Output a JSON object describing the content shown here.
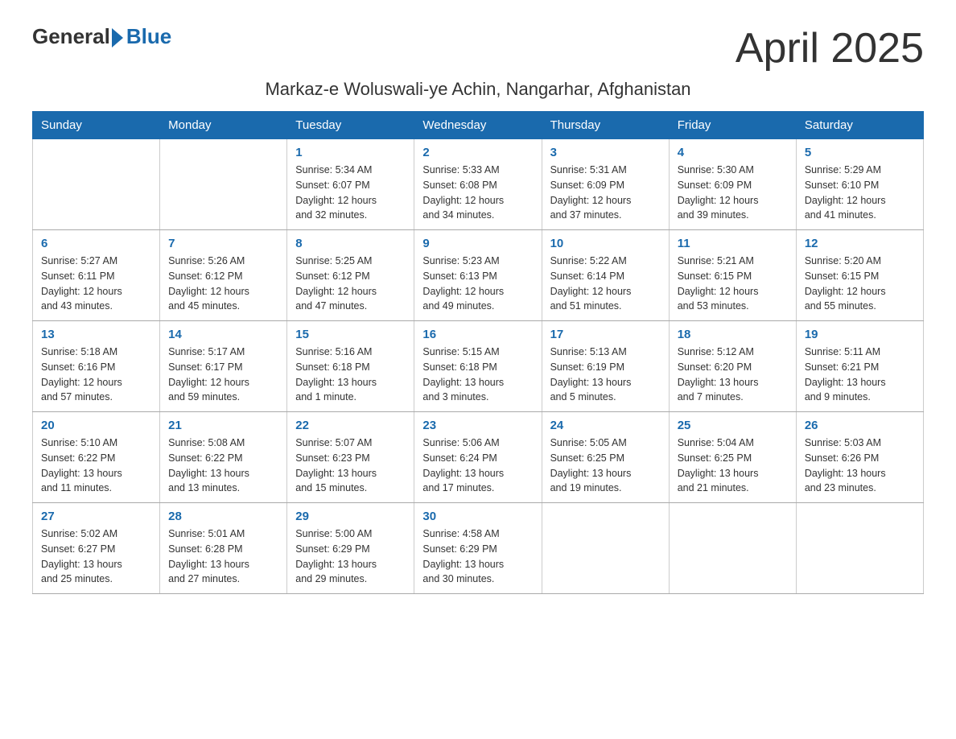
{
  "header": {
    "logo_general": "General",
    "logo_blue": "Blue",
    "month_title": "April 2025",
    "subtitle": "Markaz-e Woluswali-ye Achin, Nangarhar, Afghanistan"
  },
  "days_of_week": [
    "Sunday",
    "Monday",
    "Tuesday",
    "Wednesday",
    "Thursday",
    "Friday",
    "Saturday"
  ],
  "weeks": [
    [
      {
        "day": "",
        "info": ""
      },
      {
        "day": "",
        "info": ""
      },
      {
        "day": "1",
        "info": "Sunrise: 5:34 AM\nSunset: 6:07 PM\nDaylight: 12 hours\nand 32 minutes."
      },
      {
        "day": "2",
        "info": "Sunrise: 5:33 AM\nSunset: 6:08 PM\nDaylight: 12 hours\nand 34 minutes."
      },
      {
        "day": "3",
        "info": "Sunrise: 5:31 AM\nSunset: 6:09 PM\nDaylight: 12 hours\nand 37 minutes."
      },
      {
        "day": "4",
        "info": "Sunrise: 5:30 AM\nSunset: 6:09 PM\nDaylight: 12 hours\nand 39 minutes."
      },
      {
        "day": "5",
        "info": "Sunrise: 5:29 AM\nSunset: 6:10 PM\nDaylight: 12 hours\nand 41 minutes."
      }
    ],
    [
      {
        "day": "6",
        "info": "Sunrise: 5:27 AM\nSunset: 6:11 PM\nDaylight: 12 hours\nand 43 minutes."
      },
      {
        "day": "7",
        "info": "Sunrise: 5:26 AM\nSunset: 6:12 PM\nDaylight: 12 hours\nand 45 minutes."
      },
      {
        "day": "8",
        "info": "Sunrise: 5:25 AM\nSunset: 6:12 PM\nDaylight: 12 hours\nand 47 minutes."
      },
      {
        "day": "9",
        "info": "Sunrise: 5:23 AM\nSunset: 6:13 PM\nDaylight: 12 hours\nand 49 minutes."
      },
      {
        "day": "10",
        "info": "Sunrise: 5:22 AM\nSunset: 6:14 PM\nDaylight: 12 hours\nand 51 minutes."
      },
      {
        "day": "11",
        "info": "Sunrise: 5:21 AM\nSunset: 6:15 PM\nDaylight: 12 hours\nand 53 minutes."
      },
      {
        "day": "12",
        "info": "Sunrise: 5:20 AM\nSunset: 6:15 PM\nDaylight: 12 hours\nand 55 minutes."
      }
    ],
    [
      {
        "day": "13",
        "info": "Sunrise: 5:18 AM\nSunset: 6:16 PM\nDaylight: 12 hours\nand 57 minutes."
      },
      {
        "day": "14",
        "info": "Sunrise: 5:17 AM\nSunset: 6:17 PM\nDaylight: 12 hours\nand 59 minutes."
      },
      {
        "day": "15",
        "info": "Sunrise: 5:16 AM\nSunset: 6:18 PM\nDaylight: 13 hours\nand 1 minute."
      },
      {
        "day": "16",
        "info": "Sunrise: 5:15 AM\nSunset: 6:18 PM\nDaylight: 13 hours\nand 3 minutes."
      },
      {
        "day": "17",
        "info": "Sunrise: 5:13 AM\nSunset: 6:19 PM\nDaylight: 13 hours\nand 5 minutes."
      },
      {
        "day": "18",
        "info": "Sunrise: 5:12 AM\nSunset: 6:20 PM\nDaylight: 13 hours\nand 7 minutes."
      },
      {
        "day": "19",
        "info": "Sunrise: 5:11 AM\nSunset: 6:21 PM\nDaylight: 13 hours\nand 9 minutes."
      }
    ],
    [
      {
        "day": "20",
        "info": "Sunrise: 5:10 AM\nSunset: 6:22 PM\nDaylight: 13 hours\nand 11 minutes."
      },
      {
        "day": "21",
        "info": "Sunrise: 5:08 AM\nSunset: 6:22 PM\nDaylight: 13 hours\nand 13 minutes."
      },
      {
        "day": "22",
        "info": "Sunrise: 5:07 AM\nSunset: 6:23 PM\nDaylight: 13 hours\nand 15 minutes."
      },
      {
        "day": "23",
        "info": "Sunrise: 5:06 AM\nSunset: 6:24 PM\nDaylight: 13 hours\nand 17 minutes."
      },
      {
        "day": "24",
        "info": "Sunrise: 5:05 AM\nSunset: 6:25 PM\nDaylight: 13 hours\nand 19 minutes."
      },
      {
        "day": "25",
        "info": "Sunrise: 5:04 AM\nSunset: 6:25 PM\nDaylight: 13 hours\nand 21 minutes."
      },
      {
        "day": "26",
        "info": "Sunrise: 5:03 AM\nSunset: 6:26 PM\nDaylight: 13 hours\nand 23 minutes."
      }
    ],
    [
      {
        "day": "27",
        "info": "Sunrise: 5:02 AM\nSunset: 6:27 PM\nDaylight: 13 hours\nand 25 minutes."
      },
      {
        "day": "28",
        "info": "Sunrise: 5:01 AM\nSunset: 6:28 PM\nDaylight: 13 hours\nand 27 minutes."
      },
      {
        "day": "29",
        "info": "Sunrise: 5:00 AM\nSunset: 6:29 PM\nDaylight: 13 hours\nand 29 minutes."
      },
      {
        "day": "30",
        "info": "Sunrise: 4:58 AM\nSunset: 6:29 PM\nDaylight: 13 hours\nand 30 minutes."
      },
      {
        "day": "",
        "info": ""
      },
      {
        "day": "",
        "info": ""
      },
      {
        "day": "",
        "info": ""
      }
    ]
  ]
}
